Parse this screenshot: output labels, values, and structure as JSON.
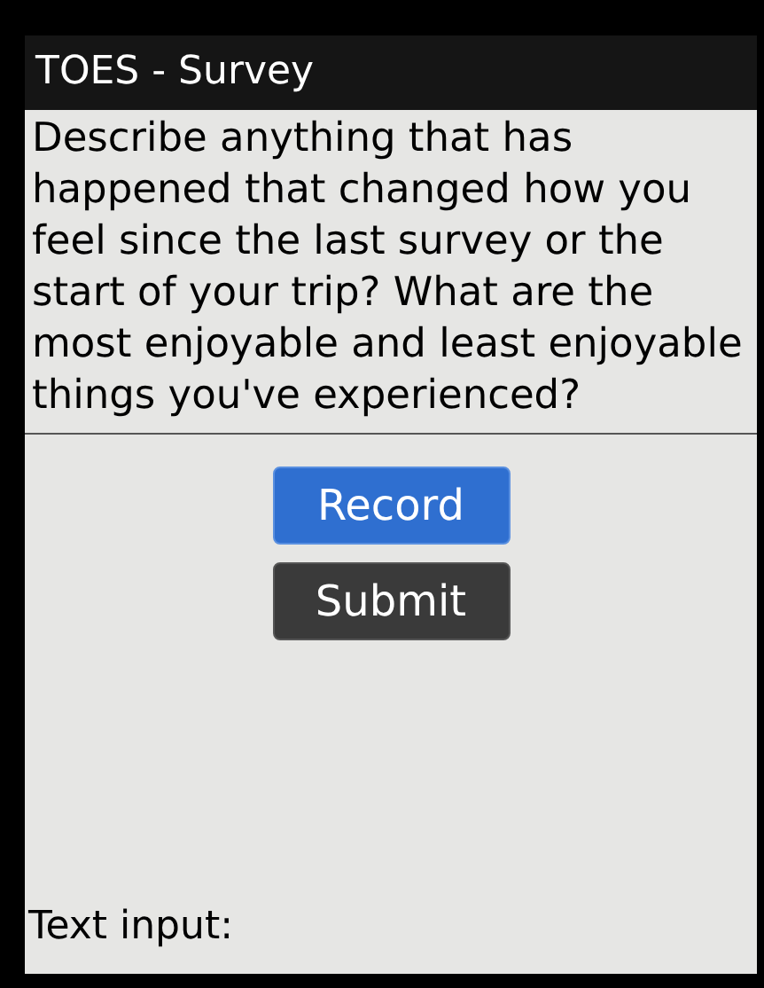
{
  "window": {
    "title": "TOES - Survey"
  },
  "question": "Describe anything that has happened that changed how you feel since the last survey or the start of your trip? What are the most enjoyable and least enjoyable things you've experienced?",
  "buttons": [
    {
      "label": "Record",
      "kind": "primary"
    },
    {
      "label": "Submit",
      "kind": "secondary"
    }
  ],
  "text_input": {
    "label": "Text input:"
  }
}
